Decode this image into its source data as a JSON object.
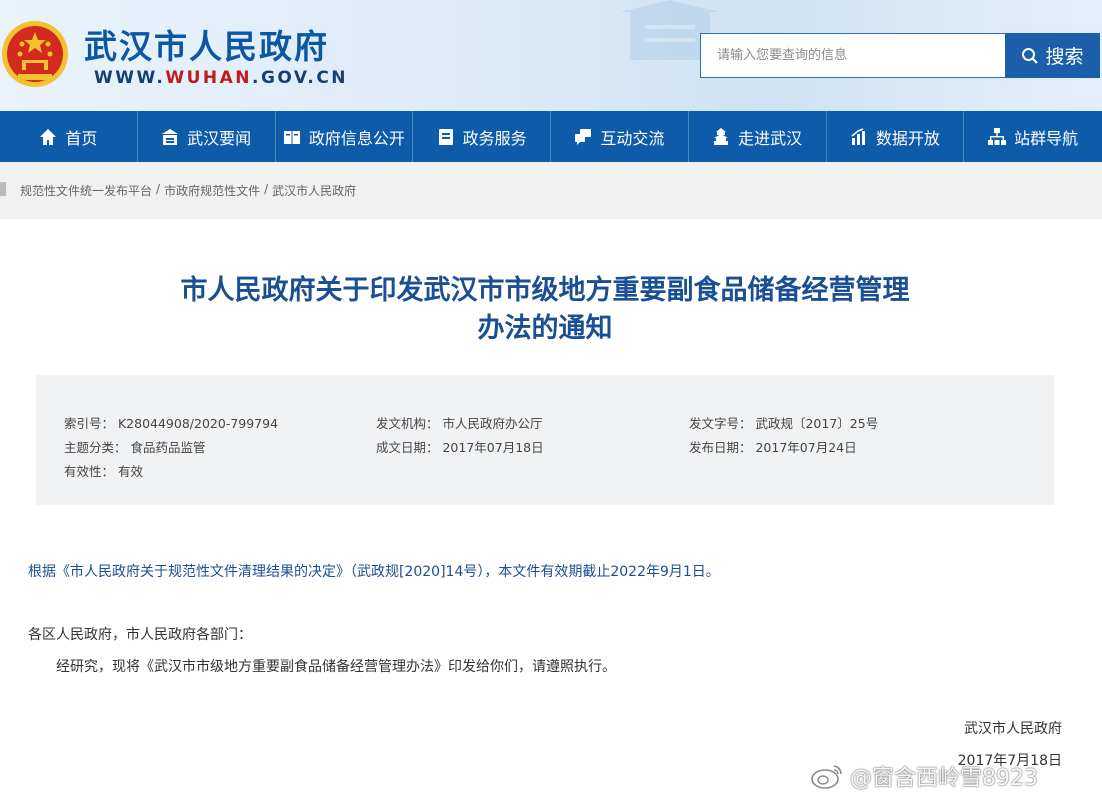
{
  "header": {
    "site_title": "武汉市人民政府",
    "site_url_prefix": "WWW.",
    "site_url_highlight": "WUHAN",
    "site_url_suffix": ".GOV.CN",
    "search_placeholder": "请输入您要查询的信息",
    "search_label": "搜索"
  },
  "nav": {
    "items": [
      {
        "label": "首页",
        "icon": "home-icon"
      },
      {
        "label": "武汉要闻",
        "icon": "news-icon"
      },
      {
        "label": "政府信息公开",
        "icon": "book-icon"
      },
      {
        "label": "政务服务",
        "icon": "service-icon"
      },
      {
        "label": "互动交流",
        "icon": "chat-icon"
      },
      {
        "label": "走进武汉",
        "icon": "tower-icon"
      },
      {
        "label": "数据开放",
        "icon": "chart-icon"
      },
      {
        "label": "站群导航",
        "icon": "sitemap-icon"
      }
    ]
  },
  "breadcrumb": {
    "items": [
      "规范性文件统一发布平台",
      "市政府规范性文件",
      "武汉市人民政府"
    ],
    "separator": "/"
  },
  "document": {
    "title_line1": "市人民政府关于印发武汉市市级地方重要副食品储备经营管理",
    "title_line2": "办法的通知",
    "meta": {
      "index_no": "索引号：  K28044908/2020-799794",
      "issuer": "发文机构：  市人民政府办公厅",
      "doc_no": "发文字号：  武政规〔2017〕25号",
      "category": "主题分类：  食品药品监管",
      "written_date": "成文日期：  2017年07月18日",
      "publish_date": "发布日期：  2017年07月24日",
      "validity": "有效性：  有效"
    },
    "notice": "根据《市人民政府关于规范性文件清理结果的决定》（武政规[2020]14号），本文件有效期截止2022年9月1日。",
    "salutation": "各区人民政府，市人民政府各部门：",
    "body": "经研究，现将《武汉市市级地方重要副食品储备经营管理办法》印发给你们，请遵照执行。",
    "signatory": "武汉市人民政府",
    "sign_date": "2017年7月18日"
  },
  "watermark": "@窗含西岭雪8923",
  "colors": {
    "brand_blue": "#0e5ca9",
    "title_blue": "#1b4f93",
    "emblem_red": "#d42a1e",
    "emblem_gold": "#f2c230"
  }
}
